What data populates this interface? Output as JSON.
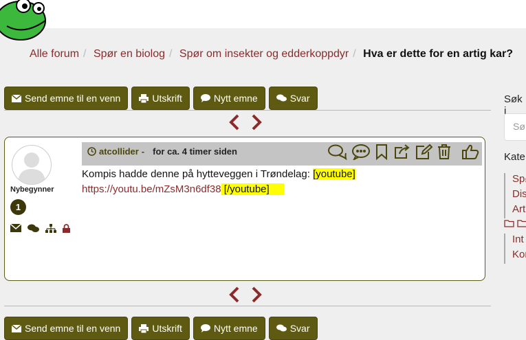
{
  "breadcrumb": {
    "items": [
      "Alle forum",
      "Spør en biolog",
      "Spør om insekter og edderkoppdyr"
    ],
    "current": "Hva er dette for en artig kar?"
  },
  "toolbar": {
    "send_label": "Send emne til en venn",
    "print_label": "Utskrift",
    "new_label": "Nytt emne",
    "reply_label": "Svar"
  },
  "post": {
    "author": "atcollider",
    "author_sep": "-",
    "time": "for ca. 4 timer siden",
    "rank": "Nybegynner",
    "post_count": "1",
    "text": "Kompis hadde denne på hytteveggen i Trøndelag: ",
    "tag_open": "[youtube]",
    "link": "https://youtu.be/mZsM3n6df38",
    "tag_close": " [/youtube]"
  },
  "sidebar": {
    "search_label": "Søk i",
    "search_placeholder": "Sø",
    "categories_label": "Kate",
    "items": [
      "Spø",
      "Dis",
      "Art"
    ],
    "folder_text": "",
    "items2": [
      "Int",
      "Kor"
    ]
  },
  "colors": {
    "button_bg": "#5f5a12",
    "link": "#8a2b2b",
    "highlight": "#ffff00"
  }
}
